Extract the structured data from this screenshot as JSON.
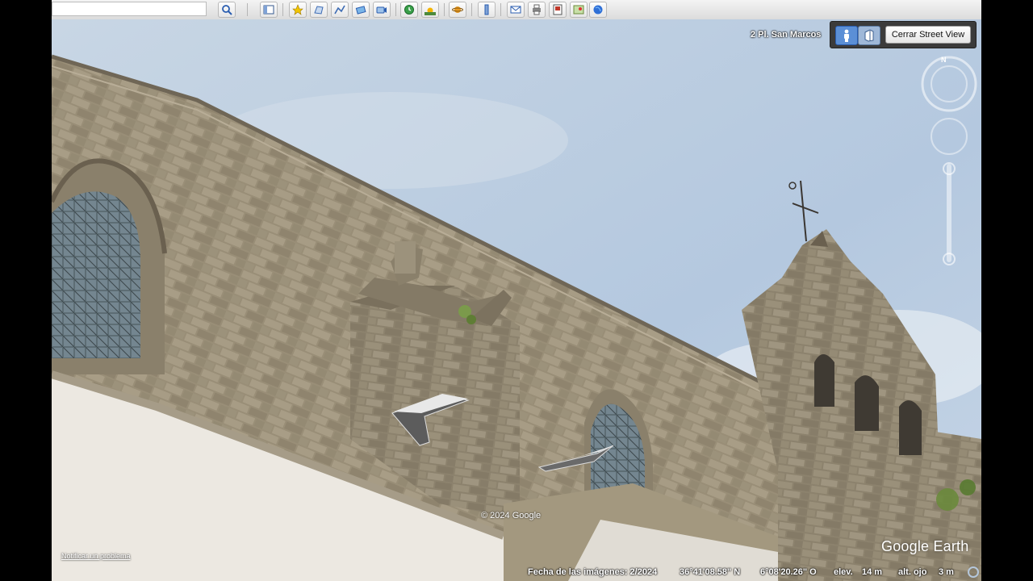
{
  "toolbar": {
    "search_placeholder": "",
    "buttons": [
      "search-icon",
      "panel-icon",
      "placemark-icon",
      "polygon-icon",
      "path-icon",
      "overlay-icon",
      "tour-icon",
      "history-icon",
      "sun-icon",
      "planet-icon",
      "ruler-icon",
      "email-icon",
      "print-icon",
      "save-image-icon",
      "map-icon",
      "earth-icon"
    ]
  },
  "street_view": {
    "address": "2 Pl. San Marcos",
    "close_label": "Cerrar Street View",
    "modes": [
      "person-icon",
      "building-icon"
    ]
  },
  "navigation": {
    "north_label": "N"
  },
  "copyright": "© 2024 Google",
  "report_link": "Notificar un problema",
  "logo": "Google Earth",
  "status": {
    "date": "Fecha de las imágenes: 2/2024",
    "lat": "36°41'08.58\" N",
    "lon": "6°08'20.26\" O",
    "elev_label": "elev.",
    "elev_value": "14 m",
    "eye_label": "alt. ojo",
    "eye_value": "3 m"
  },
  "colors": {
    "sky": "#b9cde2",
    "stone": "#9a8f79",
    "wall_white": "#e8e4dd"
  }
}
